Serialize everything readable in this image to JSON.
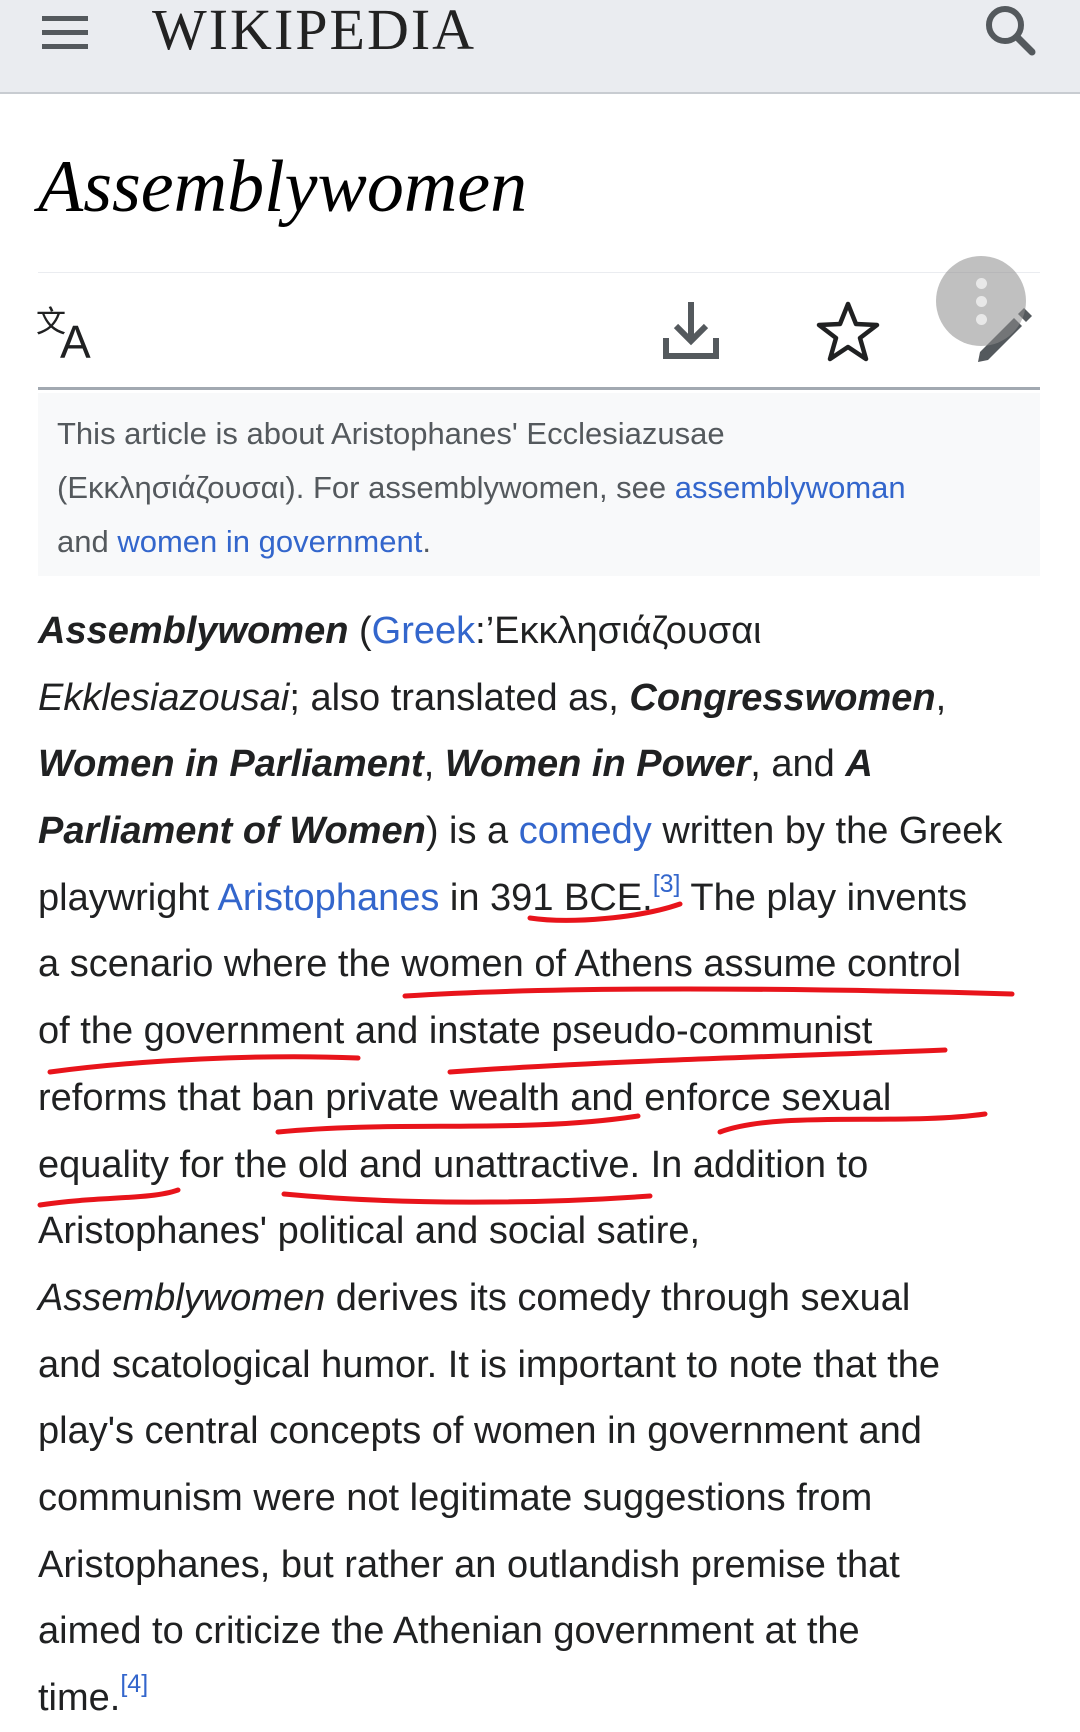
{
  "header": {
    "brand_wordmark": "WIKIPEDIA",
    "menu_icon": "hamburger-menu-icon",
    "search_icon": "search-icon"
  },
  "page": {
    "title": "Assemblywomen"
  },
  "toolbar": {
    "language_icon": "translate-icon",
    "download_icon": "download-icon",
    "watch_icon": "star-icon",
    "edit_icon": "pencil-icon",
    "overflow_icon": "vertical-dots-icon"
  },
  "hatnote": {
    "line1": "This article is about Aristophanes' Ecclesiazusae",
    "line2_text": "(Εκκλησιάζουσαι). For assemblywomen, see ",
    "link1": "assemblywoman",
    "line3_pre": "and ",
    "link2": "women in government",
    "line3_post": "."
  },
  "article": {
    "l1_bold": "Assemblywomen",
    "l1_paren": " (",
    "l1_link": "Greek",
    "l1_rest": ":’Εκκλησιάζουσαι",
    "l2_italic": "Ekklesiazousai",
    "l2_mid": "; also translated as, ",
    "l2_bold": "Congresswomen",
    "l2_end": ",",
    "l3_bold1": "Women in Parliament",
    "l3_sep": ", ",
    "l3_bold2": "Women in Power",
    "l3_and": ", and ",
    "l3_bold3": "A",
    "l4_bold": "Parliament of Women",
    "l4_mid": ") is a ",
    "l4_link": "comedy",
    "l4_end": " written by the Greek",
    "l5_start": "playwright ",
    "l5_link": "Aristophanes",
    "l5_mid": " in 391 BCE.",
    "l5_ref": "[3]",
    "l5_end": " The play invents",
    "l6": "a scenario where the women of Athens assume control",
    "l7": "of the government and instate pseudo-communist",
    "l8": "reforms that ban private wealth and enforce sexual",
    "l9": "equality for the old and unattractive. In addition to",
    "l10": "Aristophanes' political and social satire,",
    "l11_italic": "Assemblywomen",
    "l11_rest": " derives its comedy through sexual",
    "l12": "and scatological humor. It is important to note that the",
    "l13": "play's central concepts of women in government and",
    "l14": "communism were not legitimate suggestions from",
    "l15": "Aristophanes, but rather an outlandish premise that",
    "l16": "aimed to criticize the Athenian government at the",
    "l17": "time.",
    "l17_ref": "[4]"
  },
  "colors": {
    "header_bg": "#eaecf0",
    "link": "#3366cc",
    "text": "#202122",
    "annotation": "#e8141b"
  }
}
